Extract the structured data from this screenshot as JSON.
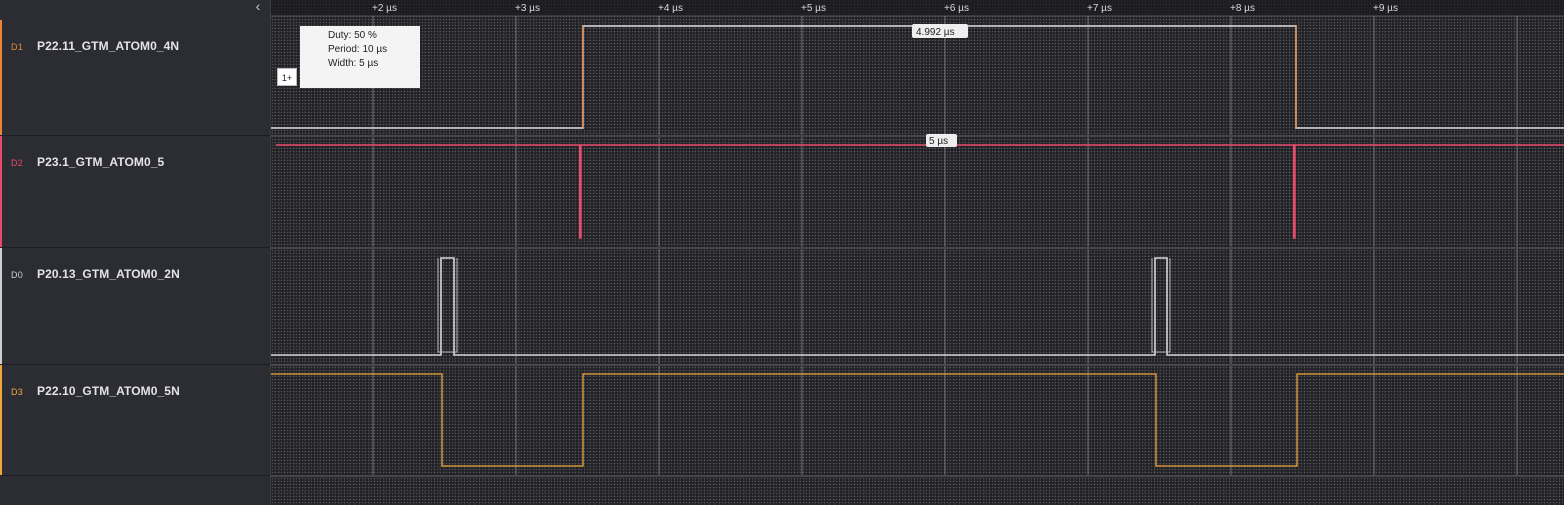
{
  "sidebar": {
    "collapse_icon": "chevron-left-icon",
    "channels": [
      {
        "tag": "D1",
        "name": "P22.11_GTM_ATOM0_4N",
        "color": "#e8873a"
      },
      {
        "tag": "D2",
        "name": "P23.1_GTM_ATOM0_5",
        "color": "#ea4a6a"
      },
      {
        "tag": "D0",
        "name": "P20.13_GTM_ATOM0_2N",
        "color": "#cfcfcf"
      },
      {
        "tag": "D3",
        "name": "P22.10_GTM_ATOM0_5N",
        "color": "#f0a63a"
      }
    ]
  },
  "timeline": {
    "ticks": [
      "+2 µs",
      "+3 µs",
      "+4 µs",
      "+5 µs",
      "+6 µs",
      "+7 µs",
      "+8 µs",
      "+9 µs"
    ]
  },
  "measurements": {
    "d1_width": "4.992 µs",
    "d2_width": "5 µs"
  },
  "info_panel": {
    "key": "1+",
    "lines": [
      "Duty: 50 %",
      "Period: 10 µs",
      "Width: 5 µs"
    ]
  },
  "colors": {
    "sidebar_bg": "#2c2d33",
    "plot_bg": "#222226",
    "d1": "#e8873a",
    "d2": "#ea4a6a",
    "d0": "#cfcfcf",
    "d3": "#f0a63a"
  }
}
